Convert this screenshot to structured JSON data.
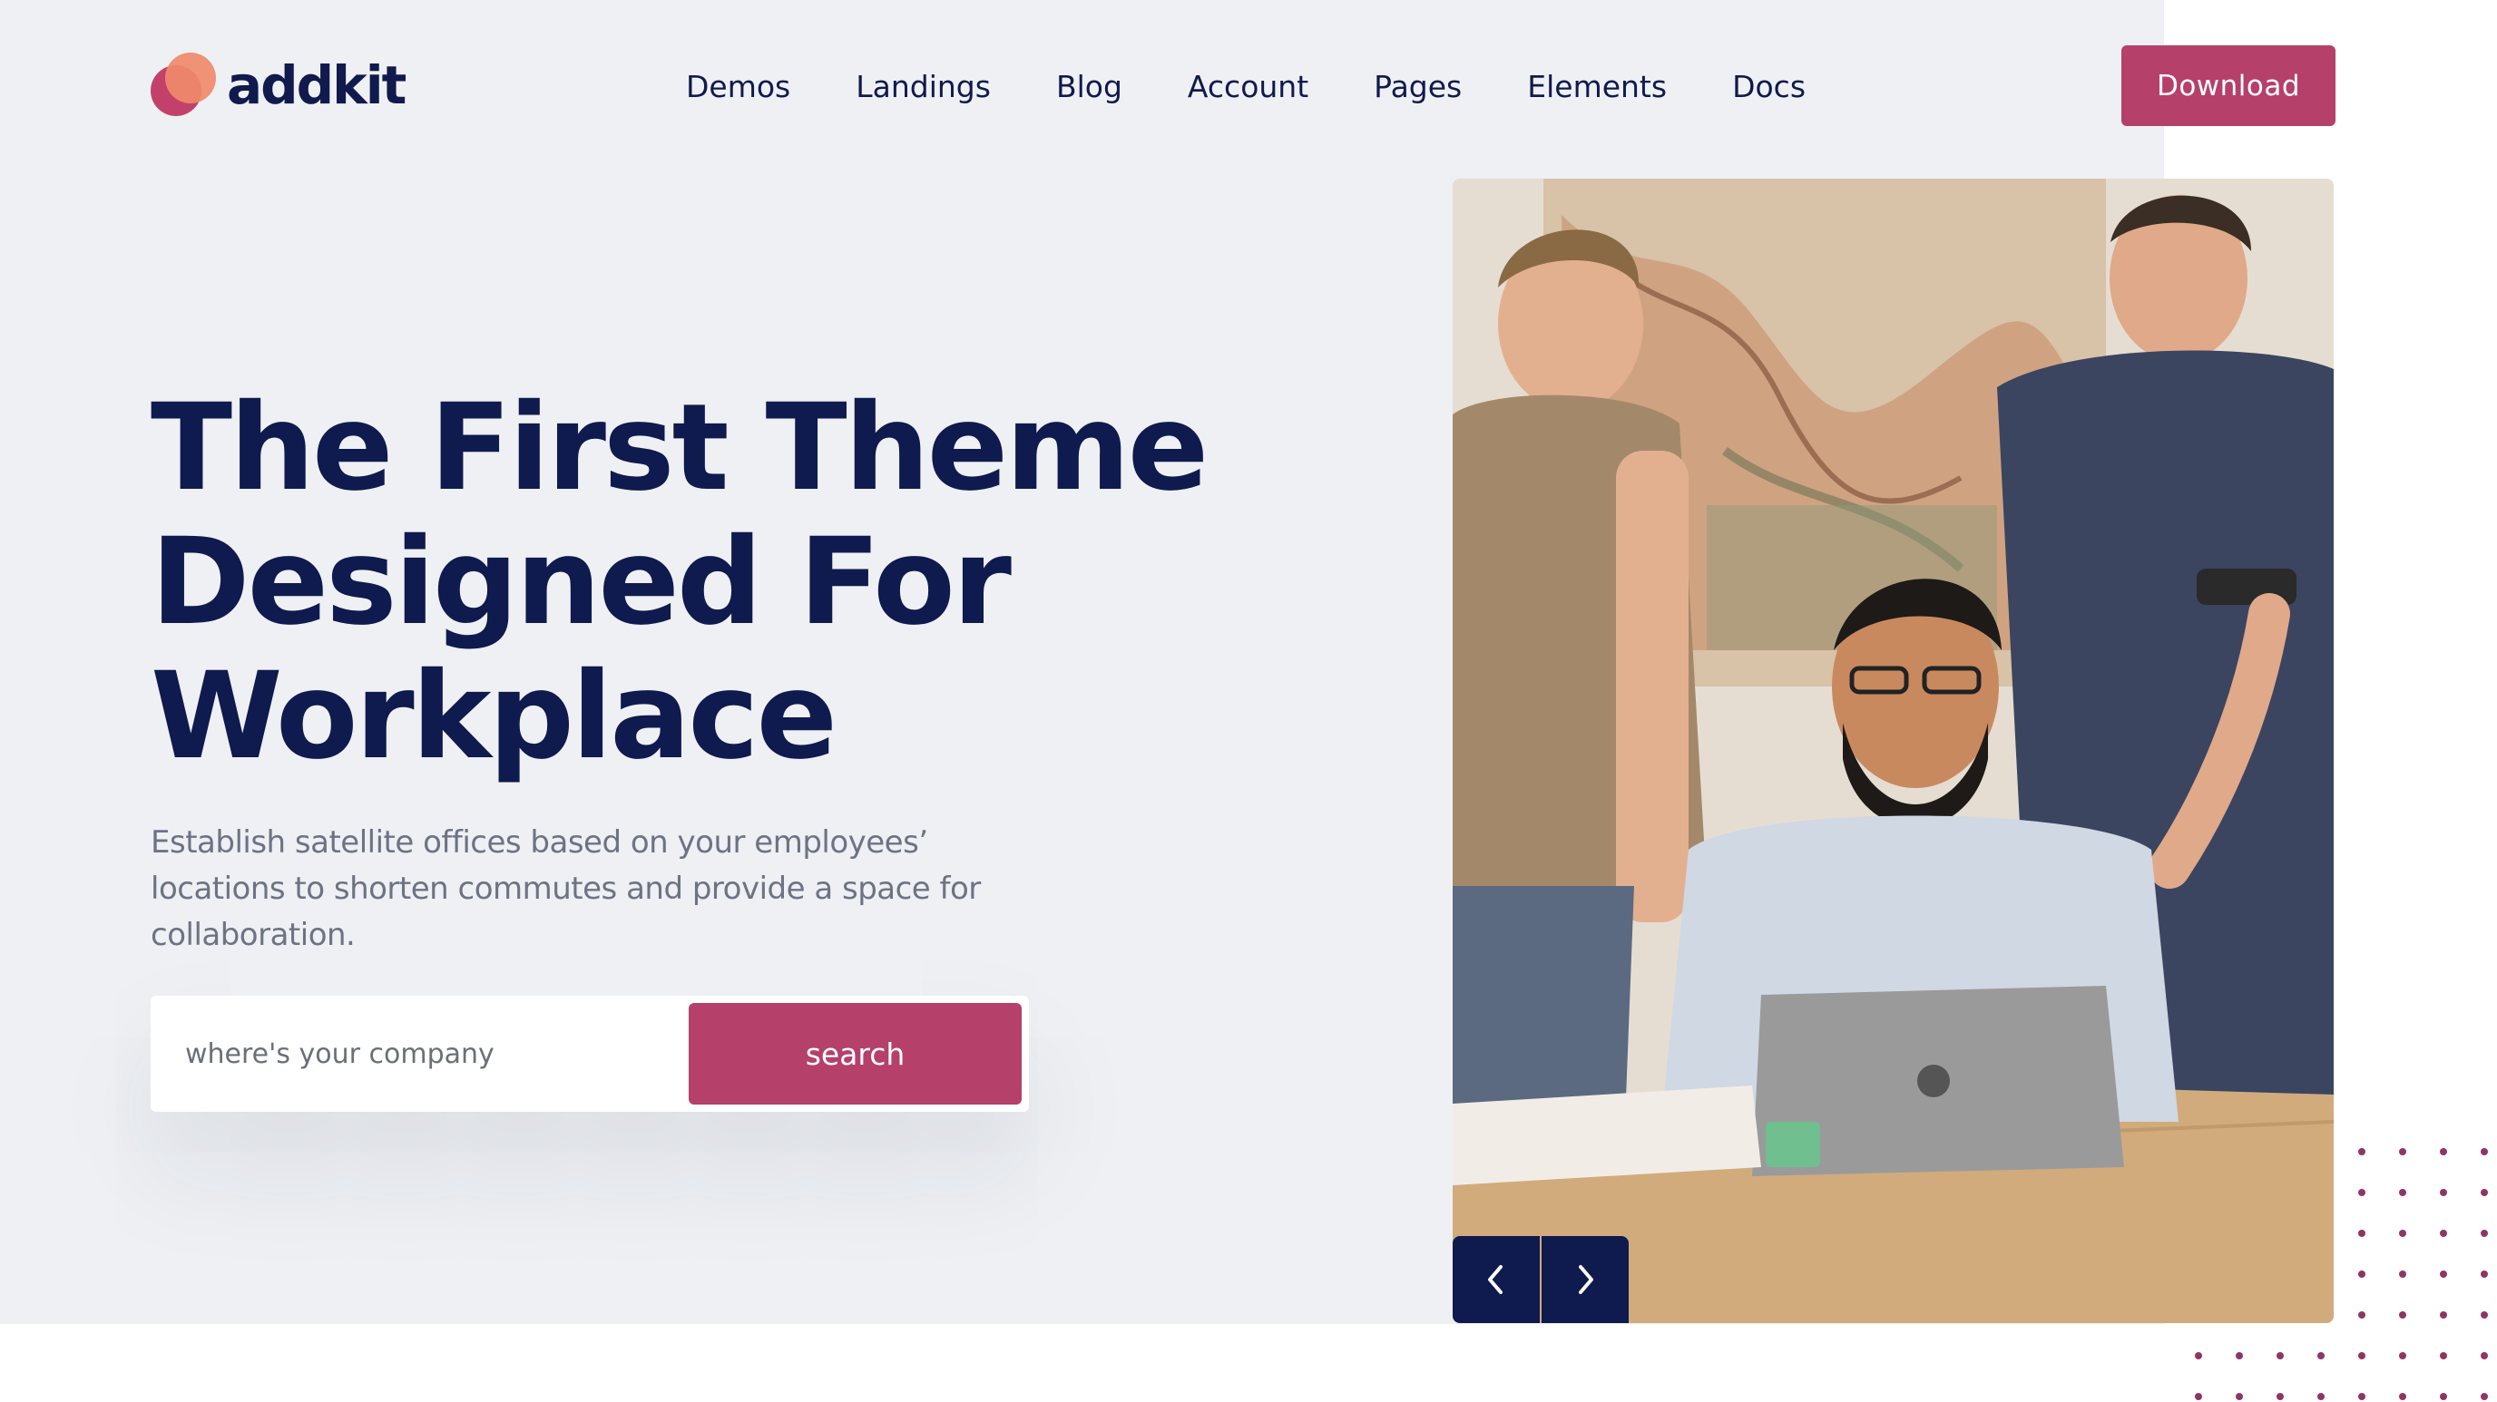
{
  "brand": {
    "name": "addkit"
  },
  "nav": {
    "items": [
      {
        "label": "Demos"
      },
      {
        "label": "Landings"
      },
      {
        "label": "Blog"
      },
      {
        "label": "Account"
      },
      {
        "label": "Pages"
      },
      {
        "label": "Elements"
      },
      {
        "label": "Docs"
      }
    ]
  },
  "header": {
    "download_label": "Download"
  },
  "hero": {
    "title_lines": [
      "The First Theme",
      "Designed For",
      "Workplace"
    ],
    "subtitle": "Establish satellite offices based on your employees’ locations to shorten commutes and provide a space for collaboration.",
    "search_placeholder": "where's your company",
    "search_button": "search"
  },
  "carousel": {
    "prev_icon": "chevron-left-icon",
    "next_icon": "chevron-right-icon"
  },
  "colors": {
    "accent": "#b5406a",
    "navy": "#0f1a4e",
    "hero_bg": "#eef0f3",
    "dots": "#8e3566"
  }
}
